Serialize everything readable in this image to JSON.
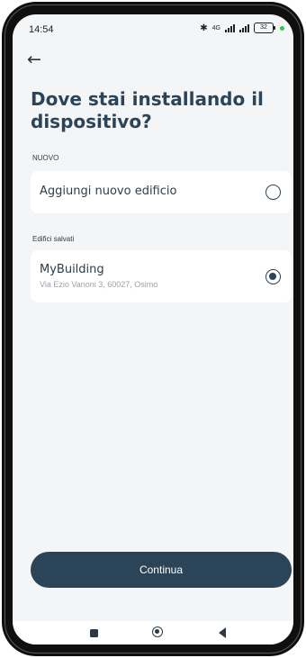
{
  "status_bar": {
    "time": "14:54",
    "network": "4G",
    "battery": "32"
  },
  "header": {
    "back_icon": "arrow-left-icon",
    "title": "Dove stai installando il dispositivo?"
  },
  "sections": {
    "new_label": "NUOVO",
    "saved_label": "Edifici salvati"
  },
  "new_building": {
    "label": "Aggiungi nuovo edificio",
    "selected": false
  },
  "saved_buildings": [
    {
      "name": "MyBuilding",
      "address": "Via Ezio Vanoni 3, 60027, Osimo",
      "selected": true
    }
  ],
  "footer": {
    "continue_label": "Continua"
  },
  "colors": {
    "primary": "#2c4457",
    "background": "#f4f5f7",
    "card": "#ffffff"
  }
}
